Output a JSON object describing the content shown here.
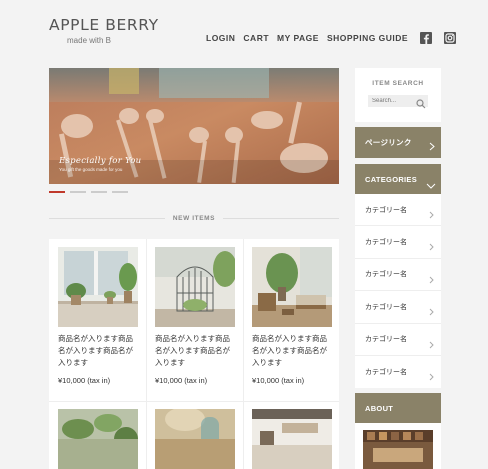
{
  "header": {
    "logo_title": "APPLE BERRY",
    "logo_sub": "made with B",
    "nav": [
      "LOGIN",
      "CART",
      "MY PAGE",
      "SHOPPING GUIDE"
    ]
  },
  "hero": {
    "caption_title": "Especially for You",
    "caption_sub": "You gift the goods made for you",
    "slides_total": 4,
    "slide_active": 1
  },
  "section": {
    "new_items": "NEW ITEMS"
  },
  "products": [
    {
      "name": "商品名が入ります商品名が入ります商品名が入ります",
      "price": "¥10,000 (tax in)"
    },
    {
      "name": "商品名が入ります商品名が入ります商品名が入ります",
      "price": "¥10,000 (tax in)"
    },
    {
      "name": "商品名が入ります商品名が入ります商品名が入ります",
      "price": "¥10,000 (tax in)"
    }
  ],
  "sidebar": {
    "search_title": "ITEM SEARCH",
    "search_placeholder": "Search...",
    "pagelink_label": "ページリンク",
    "categories_label": "CATEGORIES",
    "categories": [
      "カテゴリー名",
      "カテゴリー名",
      "カテゴリー名",
      "カテゴリー名",
      "カテゴリー名",
      "カテゴリー名"
    ],
    "about_label": "ABOUT"
  },
  "colors": {
    "accent_bar": "#8a8268",
    "slide_active": "#c0392b",
    "background": "#f3f3f3"
  },
  "icons": [
    "facebook-icon",
    "instagram-icon",
    "search-icon",
    "chevron-right-icon",
    "chevron-down-icon"
  ]
}
